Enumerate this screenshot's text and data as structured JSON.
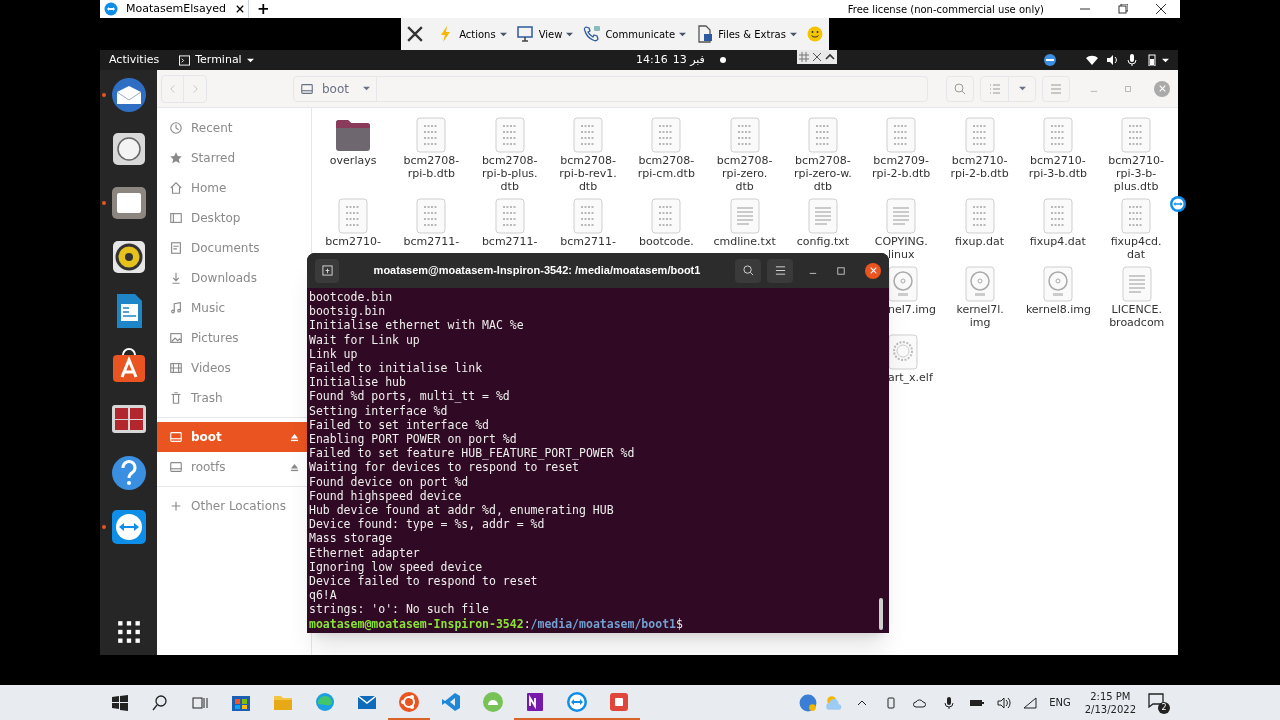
{
  "remote_window": {
    "tab": "MoatasemElsayed",
    "new_tab": "+",
    "license": "Free license (non-commercial use only)"
  },
  "remote_toolbar": [
    {
      "label": "Actions",
      "kind": "bolt"
    },
    {
      "label": "View",
      "kind": "monitor"
    },
    {
      "label": "Communicate",
      "kind": "phone"
    },
    {
      "label": "Files & Extras",
      "kind": "puzzle"
    }
  ],
  "top_bar": {
    "activities": "Activities",
    "app": "Terminal",
    "time": "14:16",
    "date": "فبر 13"
  },
  "dock": [
    {
      "kind": "mail",
      "running": true
    },
    {
      "kind": "disk",
      "running": false
    },
    {
      "kind": "files",
      "running": true
    },
    {
      "kind": "speaker",
      "running": false
    },
    {
      "kind": "writer",
      "running": false
    },
    {
      "kind": "store",
      "running": false
    },
    {
      "kind": "remmina",
      "running": false
    },
    {
      "kind": "help",
      "running": false
    },
    {
      "kind": "teamviewer",
      "running": true
    }
  ],
  "path": "boot",
  "sidebar": [
    {
      "label": "Recent",
      "kind": "clock",
      "selected": false
    },
    {
      "label": "Starred",
      "kind": "star",
      "selected": false
    },
    {
      "label": "Home",
      "kind": "home",
      "selected": false
    },
    {
      "label": "Desktop",
      "kind": "desktop",
      "selected": false
    },
    {
      "label": "Documents",
      "kind": "doc",
      "selected": false
    },
    {
      "label": "Downloads",
      "kind": "download",
      "selected": false
    },
    {
      "label": "Music",
      "kind": "music",
      "selected": false
    },
    {
      "label": "Pictures",
      "kind": "picture",
      "selected": false
    },
    {
      "label": "Videos",
      "kind": "video",
      "selected": false
    },
    {
      "label": "Trash",
      "kind": "trash",
      "selected": false
    },
    {
      "label": "boot",
      "kind": "drive",
      "selected": true
    },
    {
      "label": "rootfs",
      "kind": "drive",
      "selected": false
    },
    {
      "label": "Other Locations",
      "kind": "plus",
      "selected": false
    }
  ],
  "file_rows": [
    [
      {
        "name": "overlays",
        "kind": "folder"
      },
      {
        "name": "bcm2708-\nrpi-b.dtb",
        "kind": "binary"
      },
      {
        "name": "bcm2708-\nrpi-b-plus.\ndtb",
        "kind": "binary"
      },
      {
        "name": "bcm2708-\nrpi-b-rev1.\ndtb",
        "kind": "binary"
      },
      {
        "name": "bcm2708-\nrpi-cm.dtb",
        "kind": "binary"
      },
      {
        "name": "bcm2708-\nrpi-zero.\ndtb",
        "kind": "binary"
      },
      {
        "name": "bcm2708-\nrpi-zero-w.\ndtb",
        "kind": "binary"
      },
      {
        "name": "bcm2709-\nrpi-2-b.dtb",
        "kind": "binary"
      },
      {
        "name": "bcm2710-\nrpi-2-b.dtb",
        "kind": "binary"
      },
      {
        "name": "bcm2710-\nrpi-3-b.dtb",
        "kind": "binary"
      },
      {
        "name": "bcm2710-\nrpi-3-b-\nplus.dtb",
        "kind": "binary"
      }
    ],
    [
      {
        "name": "bcm2710-",
        "kind": "binary"
      },
      {
        "name": "bcm2711-",
        "kind": "binary"
      },
      {
        "name": "bcm2711-",
        "kind": "binary"
      },
      {
        "name": "bcm2711-",
        "kind": "binary"
      },
      {
        "name": "bootcode.",
        "kind": "binary"
      },
      {
        "name": "cmdline.txt",
        "kind": "text"
      },
      {
        "name": "config.txt",
        "kind": "text"
      },
      {
        "name": "COPYING.\nlinux",
        "kind": "text"
      },
      {
        "name": "fixup.dat",
        "kind": "binary"
      },
      {
        "name": "fixup4.dat",
        "kind": "binary"
      },
      {
        "name": "fixup4cd.\ndat",
        "kind": "binary"
      }
    ],
    [
      {
        "name": "nel7.img",
        "kind": "disc"
      },
      {
        "name": "kernel7l.\nimg",
        "kind": "disc"
      },
      {
        "name": "kernel8.img",
        "kind": "disc"
      },
      {
        "name": "LICENCE.\nbroadcom",
        "kind": "text"
      }
    ],
    [
      {
        "name": "art_x.elf",
        "kind": "gear"
      }
    ]
  ],
  "terminal": {
    "title": "moatasem@moatasem-Inspiron-3542: /media/moatasem/boot1",
    "lines": [
      "bootcode.bin",
      "bootsig.bin",
      "Initialise ethernet with MAC %e",
      "Wait for Link up",
      "Link up",
      "Failed to initialise link",
      "Initialise hub",
      "Found %d ports, multi_tt = %d",
      "Setting interface %d",
      "Failed to set interface %d",
      "Enabling PORT POWER on port %d",
      "Failed to set feature HUB_FEATURE_PORT_POWER %d",
      "Waiting for devices to respond to reset",
      "Found device on port %d",
      "Found highspeed device",
      "Hub device found at addr %d, enumerating HUB",
      "Device found: type = %s, addr = %d",
      "Mass storage",
      "Ethernet adapter",
      "Ignoring low speed device",
      "Device failed to respond to reset",
      "q6!A",
      "strings: 'o': No such file"
    ],
    "prompt_user": "moatasem@moatasem-Inspiron-3542",
    "prompt_sep": ":",
    "prompt_path": "/media/moatasem/boot1",
    "prompt_end": "$"
  },
  "taskbar": {
    "apps": [
      {
        "kind": "store",
        "running": false
      },
      {
        "kind": "explorer",
        "running": false
      },
      {
        "kind": "edge",
        "running": false
      },
      {
        "kind": "mail",
        "running": false
      },
      {
        "kind": "ubuntu",
        "running": true
      },
      {
        "kind": "vscode",
        "running": false
      },
      {
        "kind": "android",
        "running": false
      },
      {
        "kind": "onenote",
        "running": true
      },
      {
        "kind": "teamviewer",
        "running": true
      },
      {
        "kind": "recorder",
        "running": true
      }
    ],
    "language": "ENG",
    "time": "2:15 PM",
    "date": "2/13/2022",
    "notifications": "2"
  }
}
